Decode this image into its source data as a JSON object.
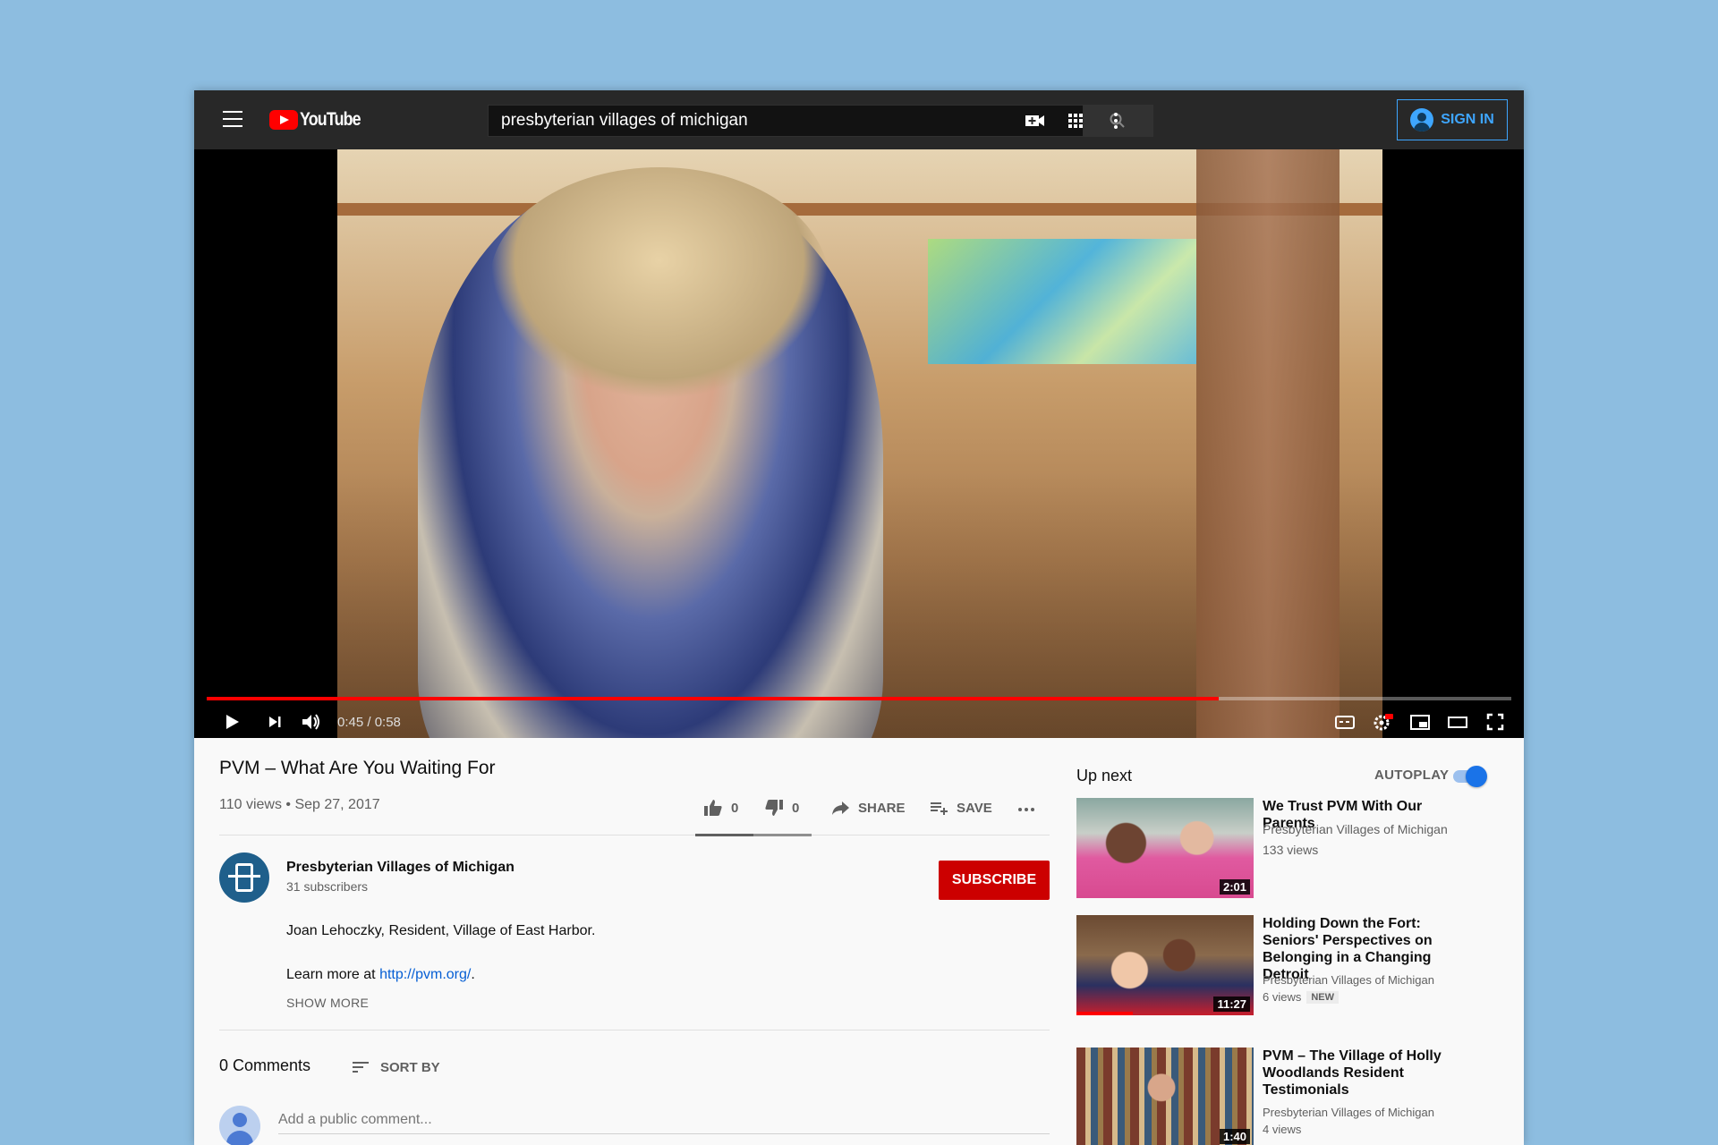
{
  "header": {
    "logo_text": "YouTube",
    "search_value": "presbyterian villages of michigan",
    "sign_in_label": "SIGN IN"
  },
  "player": {
    "time_display": "0:45 / 0:58",
    "progress_fraction": 0.776
  },
  "video": {
    "title": "PVM – What Are You Waiting For",
    "meta": "110 views • Sep 27, 2017",
    "likes": "0",
    "dislikes": "0",
    "share_label": "SHARE",
    "save_label": "SAVE"
  },
  "channel": {
    "name": "Presbyterian Villages of Michigan",
    "subscribers": "31 subscribers",
    "subscribe_label": "SUBSCRIBE"
  },
  "description": {
    "line1": "Joan Lehoczky, Resident, Village of East Harbor.",
    "learn_prefix": "Learn more at ",
    "link_text": "http://pvm.org/",
    "learn_suffix": ".",
    "show_more": "SHOW MORE"
  },
  "comments": {
    "count_label": "0 Comments",
    "sort_label": "SORT BY",
    "placeholder": "Add a public comment..."
  },
  "sidebar": {
    "up_next": "Up next",
    "autoplay_label": "AUTOPLAY",
    "autoplay_on": true,
    "videos": [
      {
        "title": "We Trust PVM With Our Parents",
        "channel": "Presbyterian Villages of Michigan",
        "views": "133 views",
        "duration": "2:01"
      },
      {
        "title": "Holding Down the Fort: Seniors' Perspectives on Belonging in a Changing Detroit",
        "channel": "Presbyterian Villages of Michigan",
        "views": "6 views",
        "badge": "NEW",
        "duration": "11:27",
        "watched_fraction": 0.32
      },
      {
        "title": "PVM – The Village of Holly Woodlands Resident Testimonials",
        "channel": "Presbyterian Villages of Michigan",
        "views": "4 views",
        "duration": "1:40"
      }
    ]
  },
  "colors": {
    "accent_red": "#ff0000",
    "subscribe_red": "#cc0000",
    "link_blue": "#065fd4",
    "signin_blue": "#3ea6ff",
    "background": "#8dbde0"
  }
}
